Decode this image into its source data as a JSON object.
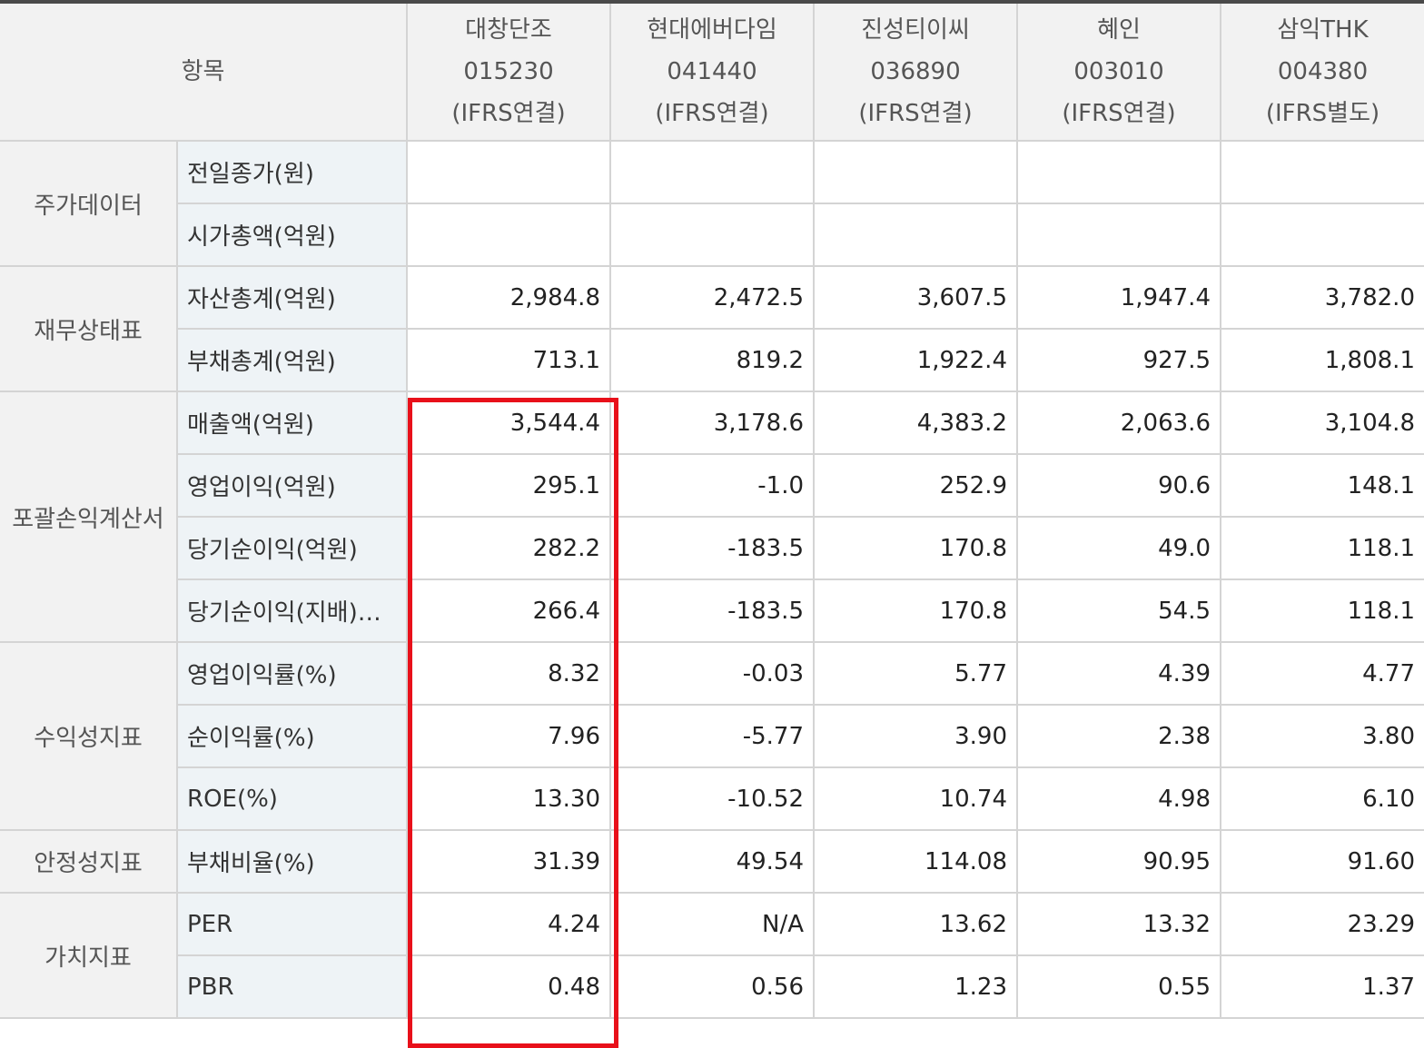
{
  "header": {
    "item_label": "항목",
    "companies": [
      {
        "name": "대창단조",
        "code": "015230",
        "basis": "(IFRS연결)"
      },
      {
        "name": "현대에버다임",
        "code": "041440",
        "basis": "(IFRS연결)"
      },
      {
        "name": "진성티이씨",
        "code": "036890",
        "basis": "(IFRS연결)"
      },
      {
        "name": "혜인",
        "code": "003010",
        "basis": "(IFRS연결)"
      },
      {
        "name": "삼익THK",
        "code": "004380",
        "basis": "(IFRS별도)"
      }
    ]
  },
  "groups": [
    {
      "label": "주가데이터",
      "rows": [
        {
          "item": "전일종가(원)",
          "values": [
            "",
            "",
            "",
            "",
            ""
          ]
        },
        {
          "item": "시가총액(억원)",
          "values": [
            "",
            "",
            "",
            "",
            ""
          ]
        }
      ]
    },
    {
      "label": "재무상태표",
      "rows": [
        {
          "item": "자산총계(억원)",
          "values": [
            "2,984.8",
            "2,472.5",
            "3,607.5",
            "1,947.4",
            "3,782.0"
          ]
        },
        {
          "item": "부채총계(억원)",
          "values": [
            "713.1",
            "819.2",
            "1,922.4",
            "927.5",
            "1,808.1"
          ]
        }
      ]
    },
    {
      "label": "포괄손익계산서",
      "rows": [
        {
          "item": "매출액(억원)",
          "values": [
            "3,544.4",
            "3,178.6",
            "4,383.2",
            "2,063.6",
            "3,104.8"
          ]
        },
        {
          "item": "영업이익(억원)",
          "values": [
            "295.1",
            "-1.0",
            "252.9",
            "90.6",
            "148.1"
          ]
        },
        {
          "item": "당기순이익(억원)",
          "values": [
            "282.2",
            "-183.5",
            "170.8",
            "49.0",
            "118.1"
          ]
        },
        {
          "item": "당기순이익(지배)…",
          "values": [
            "266.4",
            "-183.5",
            "170.8",
            "54.5",
            "118.1"
          ]
        }
      ]
    },
    {
      "label": "수익성지표",
      "rows": [
        {
          "item": "영업이익률(%)",
          "values": [
            "8.32",
            "-0.03",
            "5.77",
            "4.39",
            "4.77"
          ]
        },
        {
          "item": "순이익률(%)",
          "values": [
            "7.96",
            "-5.77",
            "3.90",
            "2.38",
            "3.80"
          ]
        },
        {
          "item": "ROE(%)",
          "values": [
            "13.30",
            "-10.52",
            "10.74",
            "4.98",
            "6.10"
          ]
        }
      ]
    },
    {
      "label": "안정성지표",
      "rows": [
        {
          "item": "부채비율(%)",
          "values": [
            "31.39",
            "49.54",
            "114.08",
            "90.95",
            "91.60"
          ]
        }
      ]
    },
    {
      "label": "가치지표",
      "rows": [
        {
          "item": "PER",
          "values": [
            "4.24",
            "N/A",
            "13.62",
            "13.32",
            "23.29"
          ]
        },
        {
          "item": "PBR",
          "values": [
            "0.48",
            "0.56",
            "1.23",
            "0.55",
            "1.37"
          ]
        }
      ]
    }
  ],
  "colors": {
    "highlight": "#e8101a",
    "header_bg": "#f2f2f2",
    "item_bg": "#eef3f6"
  }
}
